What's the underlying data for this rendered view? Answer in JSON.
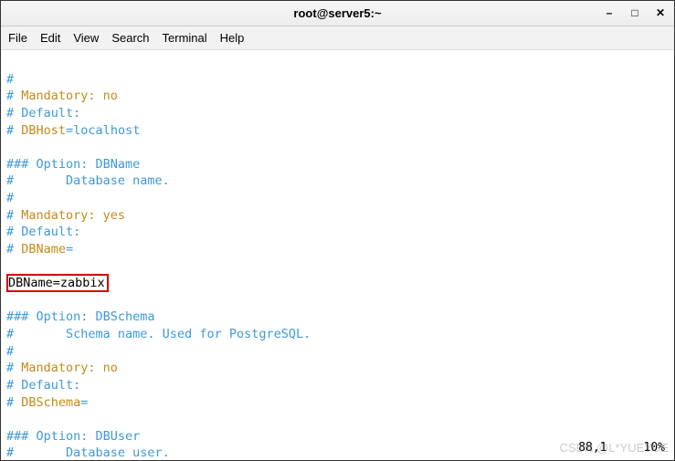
{
  "window": {
    "title": "root@server5:~"
  },
  "menu": {
    "file": "File",
    "edit": "Edit",
    "view": "View",
    "search": "Search",
    "terminal": "Terminal",
    "help": "Help"
  },
  "content": {
    "l1": "#",
    "l2a": "# ",
    "l2b": "Mandatory: no",
    "l3": "# Default:",
    "l4a": "# ",
    "l4b": "DBHost",
    "l4c": "=localhost",
    "l5": "",
    "l6": "### Option: DBName",
    "l7": "#       Database name.",
    "l8": "#",
    "l9a": "# ",
    "l9b": "Mandatory: yes",
    "l10": "# Default:",
    "l11a": "# ",
    "l11b": "DBName",
    "l11c": "=",
    "l12a": "DBName",
    "l12b": "=zabbix",
    "l13": "### Option: DBSchema",
    "l14": "#       Schema name. Used for PostgreSQL.",
    "l15": "#",
    "l16a": "# ",
    "l16b": "Mandatory: no",
    "l17": "# Default:",
    "l18a": "# ",
    "l18b": "DBSchema",
    "l18c": "=",
    "l19": "### Option: DBUser",
    "l20": "#       Database user."
  },
  "status": {
    "pos": "88,1",
    "pct": "10%"
  },
  "watermark": "CSDN @L*YUEYUE"
}
